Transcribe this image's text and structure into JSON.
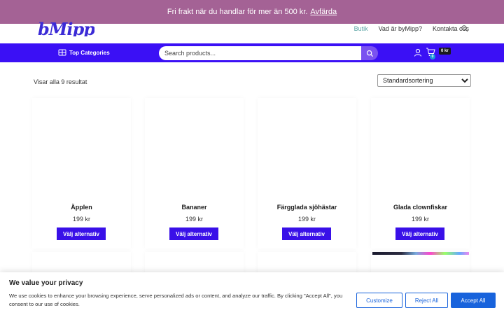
{
  "topbar": {
    "notice": "Fri frakt när du handlar för mer än 500 kr.",
    "dismiss_label": "Avfärda"
  },
  "header": {
    "logo_text": "bMipp",
    "nav": [
      {
        "label": "Butik",
        "active": true
      },
      {
        "label": "Vad är byMipp?",
        "active": false
      },
      {
        "label": "Kontakta oss",
        "active": false
      }
    ]
  },
  "bluebar": {
    "categories_label": "Top Categories",
    "search_placeholder": "Search products...",
    "cart_count": "0",
    "cart_total": "0 kr"
  },
  "shop": {
    "result_count": "Visar alla 9 resultat",
    "sort_selected": "Standardsortering"
  },
  "products": [
    {
      "name": "Äpplen",
      "price": "199 kr",
      "button": "Välj alternativ"
    },
    {
      "name": "Bananer",
      "price": "199 kr",
      "button": "Välj alternativ"
    },
    {
      "name": "Färgglada sjöhästar",
      "price": "199 kr",
      "button": "Välj alternativ"
    },
    {
      "name": "Glada clownfiskar",
      "price": "199 kr",
      "button": "Välj alternativ"
    }
  ],
  "cookie": {
    "title": "We value your privacy",
    "text": "We use cookies to enhance your browsing experience, serve personalized ads or content, and analyze our traffic. By clicking \"Accept All\", you consent to our use of cookies.",
    "customize": "Customize",
    "reject": "Reject All",
    "accept": "Accept All"
  },
  "colors": {
    "topbar": "#a46295",
    "bluebar": "#3b10f5",
    "button": "#3910e8",
    "cookie_blue": "#1863dc",
    "nav_active": "#5aa5a5"
  },
  "icons": [
    "search-icon",
    "grid-icon",
    "user-icon",
    "cart-icon"
  ]
}
